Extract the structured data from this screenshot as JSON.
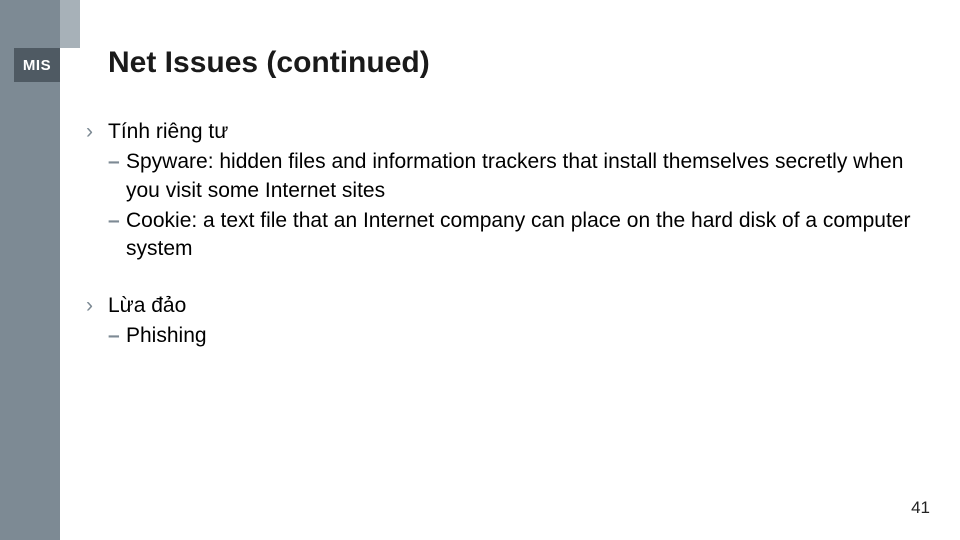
{
  "badge": "MIS",
  "title": "Net Issues (continued)",
  "page_number": "41",
  "markers": {
    "bullet": "›",
    "sub": "–"
  },
  "bullets": [
    {
      "head": "Tính riêng tư",
      "subs": [
        "Spyware: hidden files and information trackers that install themselves secretly when you visit some Internet sites",
        "Cookie: a text file that an Internet company can place on the hard disk of a computer system"
      ]
    },
    {
      "head": "Lừa đảo",
      "subs": [
        "Phishing"
      ]
    }
  ]
}
